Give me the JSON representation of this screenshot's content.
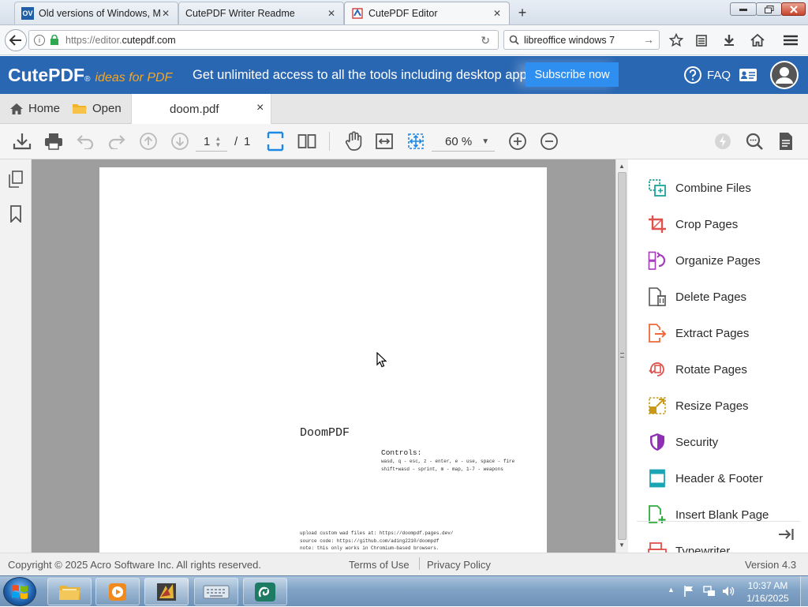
{
  "browser": {
    "tabs": [
      {
        "title": "Old versions of Windows, M",
        "favicon_text": "OV"
      },
      {
        "title": "CutePDF Writer Readme"
      },
      {
        "title": "CutePDF Editor"
      }
    ],
    "url_prefix": "https://editor.",
    "url_domain": "cutepdf.com",
    "search_value": "libreoffice windows 7"
  },
  "header": {
    "logo": "CutePDF",
    "logo_reg": "®",
    "tagline": "ideas for PDF",
    "promo": "Get unlimited access to all the tools including desktop app!",
    "subscribe_label": "Subscribe now",
    "faq_label": "FAQ"
  },
  "apptabs": {
    "home_label": "Home",
    "open_label": "Open",
    "doc_name": "doom.pdf",
    "close_glyph": "×"
  },
  "toolbar": {
    "page_current": "1",
    "page_separator": "/",
    "page_total": "1",
    "zoom": "60 %"
  },
  "document": {
    "title": "DoomPDF",
    "controls_heading": "Controls:",
    "controls_line1": "wasd, q - esc, z - enter, e - use, space - fire",
    "controls_line2": "shift+wasd - sprint, m - map, 1-7 - weapons",
    "footer_line1": "upload custom wad files at: https://doompdf.pages.dev/",
    "footer_line2": "source code: https://github.com/ading2210/doompdf",
    "footer_line3": "note: this only works in Chromium-based browsers."
  },
  "tools": [
    {
      "label": "Combine Files",
      "icon": "combine-files-icon",
      "color": "#1aa59a"
    },
    {
      "label": "Crop Pages",
      "icon": "crop-icon",
      "color": "#e0524e"
    },
    {
      "label": "Organize Pages",
      "icon": "organize-pages-icon",
      "color": "#a43bbd"
    },
    {
      "label": "Delete Pages",
      "icon": "delete-pages-icon",
      "color": "#555555"
    },
    {
      "label": "Extract Pages",
      "icon": "extract-pages-icon",
      "color": "#ef6a3a"
    },
    {
      "label": "Rotate Pages",
      "icon": "rotate-pages-icon",
      "color": "#e0524e"
    },
    {
      "label": "Resize Pages",
      "icon": "resize-pages-icon",
      "color": "#c99a18"
    },
    {
      "label": "Security",
      "icon": "shield-icon",
      "color": "#8e2fb5"
    },
    {
      "label": "Header & Footer",
      "icon": "header-footer-icon",
      "color": "#1aa5b5"
    },
    {
      "label": "Insert Blank Page",
      "icon": "insert-blank-page-icon",
      "color": "#2eaa3f"
    },
    {
      "label": "Typewriter",
      "icon": "typewriter-icon",
      "color": "#e0524e"
    }
  ],
  "footer": {
    "copyright": "Copyright © 2025 Acro Software Inc. All rights reserved.",
    "terms": "Terms of Use",
    "privacy": "Privacy Policy",
    "version": "Version 4.3"
  },
  "taskbar": {
    "time": "10:37 AM",
    "date": "1/16/2025"
  },
  "colors": {
    "brand_blue": "#2a67b2",
    "subscribe_blue": "#2e8ff0",
    "accent_blue": "#1e88e5",
    "tagline_orange": "#f5a623"
  }
}
